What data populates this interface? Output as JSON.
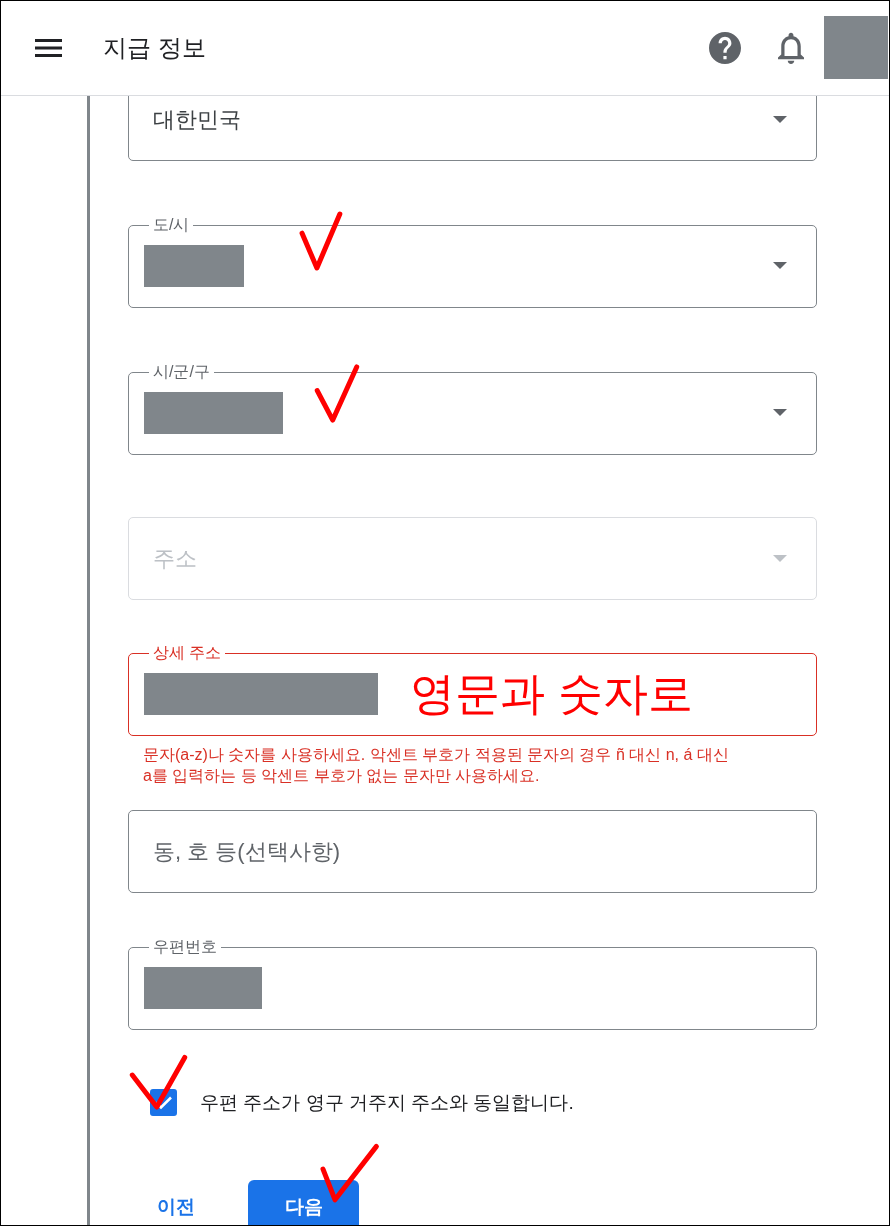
{
  "header": {
    "title": "지급 정보"
  },
  "fields": [
    {
      "kind": "select",
      "value": "대한민국",
      "redacted": false,
      "disabled": false,
      "error": false,
      "tick_mark": false
    },
    {
      "kind": "select",
      "label": "도/시",
      "redacted": true,
      "disabled": false,
      "error": false,
      "tick_mark": true
    },
    {
      "kind": "select",
      "label": "시/군/구",
      "redacted": true,
      "disabled": false,
      "error": false,
      "tick_mark": true
    },
    {
      "kind": "select",
      "placeholder": "주소",
      "redacted": false,
      "disabled": true,
      "error": false,
      "tick_mark": false
    },
    {
      "kind": "text",
      "label": "상세 주소",
      "redacted": true,
      "note": "영문과 숫자로",
      "disabled": false,
      "error": true,
      "error_text": "문자(a-z)나 숫자를 사용하세요. 악센트 부호가 적용된 문자의 경우 ñ 대신 n, á 대신 a를 입력하는 등 악센트 부호가 없는 문자만 사용하세요.",
      "tick_mark": false
    },
    {
      "kind": "text",
      "placeholder": "동, 호 등(선택사항)",
      "redacted": false,
      "disabled": false,
      "error": false,
      "tick_mark": false
    },
    {
      "kind": "text",
      "label": "우편번호",
      "redacted": true,
      "disabled": false,
      "error": false,
      "tick_mark": false
    }
  ],
  "checkbox": {
    "label": "우편 주소가 영구 거주지 주소와 동일합니다.",
    "checked": true,
    "tick_mark": true
  },
  "buttons": [
    {
      "label": "이전",
      "kind": "text",
      "tick_mark": false
    },
    {
      "label": "다음",
      "kind": "filled",
      "tick_mark": true
    }
  ]
}
